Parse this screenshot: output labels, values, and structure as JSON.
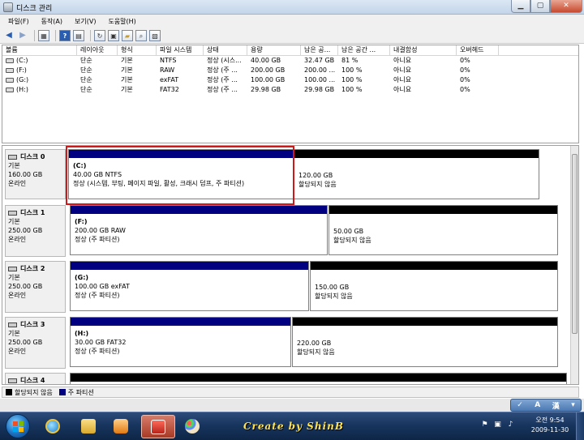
{
  "window": {
    "title": "디스크 관리"
  },
  "menu": [
    "파일(F)",
    "동작(A)",
    "보기(V)",
    "도움말(H)"
  ],
  "volume_table": {
    "headers": [
      "볼륨",
      "레이아웃",
      "형식",
      "파일 시스템",
      "상태",
      "용량",
      "남은 공...",
      "남은 공간 ...",
      "내결함성",
      "오버헤드"
    ],
    "rows": [
      [
        "(C:)",
        "단순",
        "기본",
        "NTFS",
        "정상 (시스...",
        "40.00 GB",
        "32.47 GB",
        "81 %",
        "아니요",
        "0%"
      ],
      [
        "(F:)",
        "단순",
        "기본",
        "RAW",
        "정상 (주 ...",
        "200.00 GB",
        "200.00 ...",
        "100 %",
        "아니요",
        "0%"
      ],
      [
        "(G:)",
        "단순",
        "기본",
        "exFAT",
        "정상 (주 ...",
        "100.00 GB",
        "100.00 ...",
        "100 %",
        "아니요",
        "0%"
      ],
      [
        "(H:)",
        "단순",
        "기본",
        "FAT32",
        "정상 (주 ...",
        "29.98 GB",
        "29.98 GB",
        "100 %",
        "아니요",
        "0%"
      ]
    ]
  },
  "disks": [
    {
      "name": "디스크 0",
      "type": "기본",
      "size": "160.00 GB",
      "status": "온라인",
      "partitions": [
        {
          "kind": "primary",
          "label": "(C:)",
          "line1": "40.00 GB NTFS",
          "line2": "정상 (시스템, 부팅, 페이지 파일, 활성, 크래시 덤프, 주 파티션)",
          "fraction": 0.475
        },
        {
          "kind": "unalloc",
          "label": "",
          "line1": "120.00 GB",
          "line2": "할당되지 않음",
          "fraction": 0.525
        }
      ]
    },
    {
      "name": "디스크 1",
      "type": "기본",
      "size": "250.00 GB",
      "status": "온라인",
      "partitions": [
        {
          "kind": "primary",
          "label": "(F:)",
          "line1": "200.00 GB RAW",
          "line2": "정상 (주 파티션)",
          "fraction": 0.52
        },
        {
          "kind": "unalloc",
          "label": "",
          "line1": "50.00 GB",
          "line2": "할당되지 않음",
          "fraction": 0.48
        }
      ]
    },
    {
      "name": "디스크 2",
      "type": "기본",
      "size": "250.00 GB",
      "status": "온라인",
      "partitions": [
        {
          "kind": "primary",
          "label": "(G:)",
          "line1": "100.00 GB exFAT",
          "line2": "정상 (주 파티션)",
          "fraction": 0.49
        },
        {
          "kind": "unalloc",
          "label": "",
          "line1": "150.00 GB",
          "line2": "할당되지 않음",
          "fraction": 0.51
        }
      ]
    },
    {
      "name": "디스크 3",
      "type": "기본",
      "size": "250.00 GB",
      "status": "온라인",
      "partitions": [
        {
          "kind": "primary",
          "label": "(H:)",
          "line1": "30.00 GB FAT32",
          "line2": "정상 (주 파티션)",
          "fraction": 0.455
        },
        {
          "kind": "unalloc",
          "label": "",
          "line1": "220.00 GB",
          "line2": "할당되지 않음",
          "fraction": 0.545
        }
      ]
    },
    {
      "name": "디스크 4",
      "type": "",
      "size": "",
      "status": "",
      "partitions": []
    }
  ],
  "legend": [
    {
      "label": "할당되지 않음",
      "color": "#000000"
    },
    {
      "label": "주 파티션",
      "color": "#000080"
    }
  ],
  "ime": {
    "mode": "A",
    "hanja": "漢"
  },
  "taskbar": {
    "watermark": "Create by ShinB"
  },
  "clock": {
    "time": "오전 9:54",
    "date": "2009-11-30"
  }
}
